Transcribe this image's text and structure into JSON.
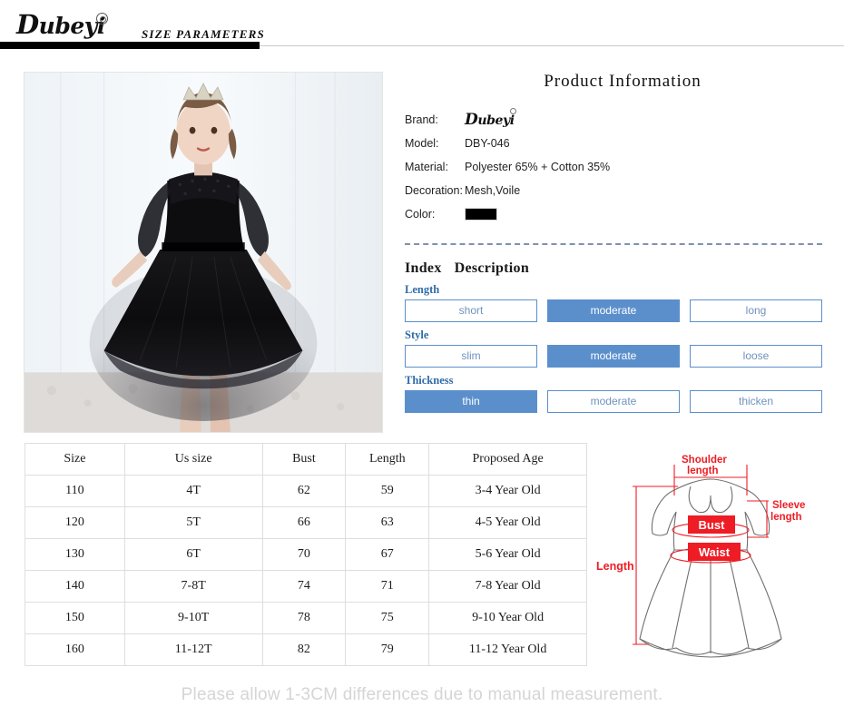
{
  "header": {
    "logo_text": "Dubeyi",
    "logo_cap": "D",
    "logo_rest": "ubey",
    "logo_tail": "i",
    "title": "SIZE  PARAMETERS"
  },
  "photo": {
    "alt": "girl wearing black tulle party dress with tiara",
    "icon": "product-photo"
  },
  "product_info": {
    "title": "Product  Information",
    "rows": [
      {
        "label": "Brand:",
        "value": "Dubeyi",
        "type": "brand"
      },
      {
        "label": "Model:",
        "value": "DBY-046",
        "type": "text"
      },
      {
        "label": "Material:",
        "value": "Polyester 65% + Cotton 35%",
        "type": "text"
      },
      {
        "label": "Decoration:",
        "value": "Mesh,Voile",
        "type": "text"
      },
      {
        "label": "Color:",
        "value": "#000000",
        "type": "swatch"
      }
    ]
  },
  "index": {
    "heading_index": "Index",
    "heading_description": "Description",
    "accent_color": "#5b8fcc",
    "groups": [
      {
        "label": "Length",
        "options": [
          {
            "text": "short",
            "selected": false
          },
          {
            "text": "moderate",
            "selected": true
          },
          {
            "text": "long",
            "selected": false
          }
        ]
      },
      {
        "label": "Style",
        "options": [
          {
            "text": "slim",
            "selected": false
          },
          {
            "text": "moderate",
            "selected": true
          },
          {
            "text": "loose",
            "selected": false
          }
        ]
      },
      {
        "label": "Thickness",
        "options": [
          {
            "text": "thin",
            "selected": true
          },
          {
            "text": "moderate",
            "selected": false
          },
          {
            "text": "thicken",
            "selected": false
          }
        ]
      }
    ]
  },
  "size_table": {
    "columns": [
      "Size",
      "Us size",
      "Bust",
      "Length",
      "Proposed Age"
    ],
    "rows": [
      [
        "110",
        "4T",
        "62",
        "59",
        "3-4 Year Old"
      ],
      [
        "120",
        "5T",
        "66",
        "63",
        "4-5 Year Old"
      ],
      [
        "130",
        "6T",
        "70",
        "67",
        "5-6 Year Old"
      ],
      [
        "140",
        "7-8T",
        "74",
        "71",
        "7-8 Year Old"
      ],
      [
        "150",
        "9-10T",
        "78",
        "75",
        "9-10 Year Old"
      ],
      [
        "160",
        "11-12T",
        "82",
        "79",
        "11-12 Year Old"
      ]
    ]
  },
  "diagram": {
    "accent_color": "#ee1c24",
    "labels": {
      "shoulder_line1": "Shoulder",
      "shoulder_line2": "length",
      "sleeve_line1": "Sleeve",
      "sleeve_line2": "length",
      "bust": "Bust",
      "waist": "Waist",
      "length": "Length"
    }
  },
  "footer": {
    "note": "Please allow 1-3CM differences due to manual measurement."
  }
}
